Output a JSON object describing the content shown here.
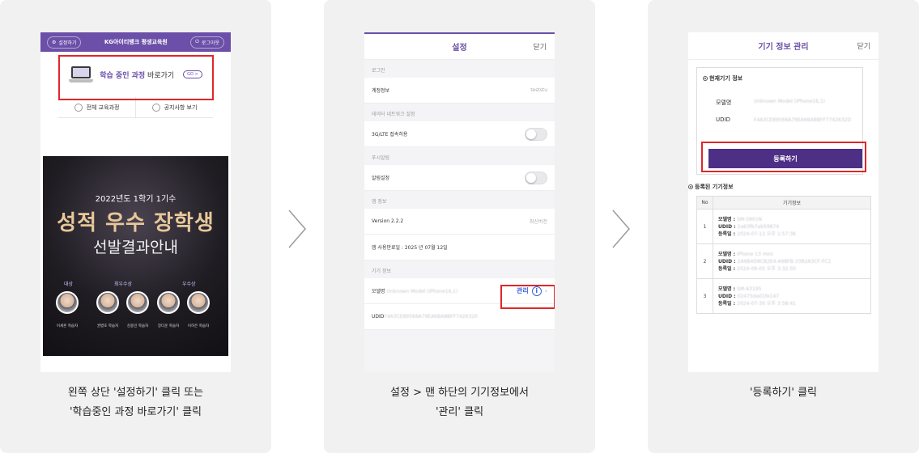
{
  "step1": {
    "top_left": "설정하기",
    "brand": "KG아이티뱅크 평생교육원",
    "logout": "로그아웃",
    "shortcut_strong": "학습 중인 과정",
    "shortcut_rest": " 바로가기",
    "shortcut_go": "GO >",
    "menu": [
      "전체 교육과정",
      "공지사항 보기"
    ],
    "banner_line1": "2022년도 1학기 1기수",
    "banner_line2": "성적 우수 장학생",
    "banner_line3": "선발결과안내",
    "award_labels": [
      "대상",
      "최우수상",
      "우수상"
    ],
    "names": [
      "이세훈 학습자",
      "권병호 학습자",
      "김용민 학습자",
      "장다운 학습자",
      "이하은 학습자"
    ],
    "caption_1": "왼쪽 상단 '설정하기' 클릭 또는",
    "caption_2": "'학습중인 과정 바로가기' 클릭"
  },
  "step2": {
    "title": "설정",
    "close": "닫기",
    "sec_login": "로그인",
    "account_label": "계정정보",
    "account_value": "teststu",
    "sec_network": "데이터 네트워크 설정",
    "network_label": "3G/LTE 접속허용",
    "sec_push": "푸시알림",
    "push_label": "알림설정",
    "sec_app": "앱 정보",
    "version_label": "Version 2.2.2",
    "version_value": "최신버전",
    "last_used": "앱 사용만료일 : 2025 년 07월 12일",
    "sec_device": "기기 정보",
    "model_label": "모델명",
    "model_value": "Unknown Model (iPhone16,1)",
    "manage": "관리",
    "udid_label": "UDID",
    "udid_value": "F4A3CE89566A79EA6BA8BFF7426320",
    "caption_1": "설정 > 맨 하단의 기기정보에서",
    "caption_2": "'관리' 클릭"
  },
  "step3": {
    "title": "기기 정보 관리",
    "close": "닫기",
    "current_title": "현재기기 정보",
    "model_label": "모델명",
    "model_value": "Unknown Model (iPhone16,1)",
    "udid_label": "UDID",
    "udid_value": "F4A3CE89566A79EA6BA8BFF7742632D",
    "register": "등록하기",
    "registered_title": "등록된 기기정보",
    "col_no": "No",
    "col_info": "기기정보",
    "k_model": "모델명 : ",
    "k_udid": "UDID : ",
    "k_date": "등록일 : ",
    "rows": [
      {
        "no": "1",
        "model": "SM-S901N",
        "udid": "2a63fb7ab59874",
        "date": "2024-07-12 오후 1:57:36"
      },
      {
        "no": "2",
        "model": "iPhone 13 mini",
        "udid": "2A6B4D9CB2E4-A98FB-3382A3CF-FC1",
        "date": "2024-06-05 오후 3:32:50"
      },
      {
        "no": "3",
        "model": "SM-A3195",
        "udid": "02475da01fe147",
        "date": "2024-07-30 오후 3:58:41"
      }
    ],
    "caption": "'등록하기' 클릭"
  }
}
